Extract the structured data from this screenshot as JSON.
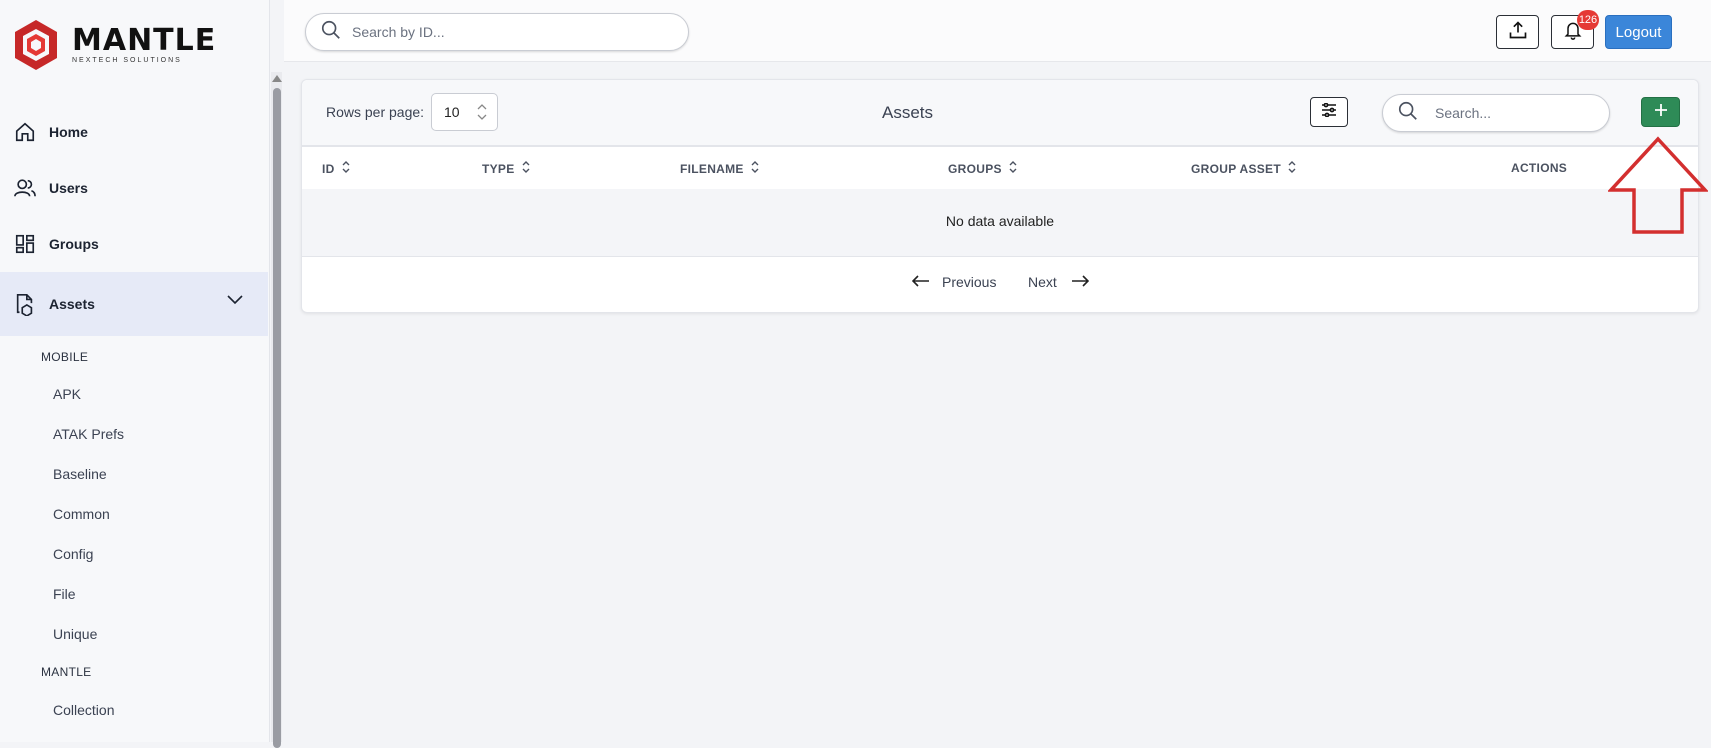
{
  "brand": {
    "name": "MANTLE",
    "tagline": "NEXTECH SOLUTIONS"
  },
  "sidebar": {
    "items": [
      {
        "label": "Home",
        "icon": "home-icon"
      },
      {
        "label": "Users",
        "icon": "users-icon"
      },
      {
        "label": "Groups",
        "icon": "groups-icon"
      },
      {
        "label": "Assets",
        "icon": "assets-icon"
      }
    ],
    "sections": [
      {
        "heading": "MOBILE",
        "items": [
          "APK",
          "ATAK Prefs",
          "Baseline",
          "Common",
          "Config",
          "File",
          "Unique"
        ]
      },
      {
        "heading": "MANTLE",
        "items": [
          "Collection"
        ]
      }
    ]
  },
  "topbar": {
    "search_placeholder": "Search by ID...",
    "notification_count": "126",
    "logout_label": "Logout"
  },
  "card": {
    "rows_per_page_label": "Rows per page:",
    "rows_per_page_value": "10",
    "title": "Assets",
    "search_placeholder": "Search...",
    "columns": [
      "ID",
      "TYPE",
      "FILENAME",
      "GROUPS",
      "GROUP ASSET",
      "ACTIONS"
    ],
    "empty_message": "No data available",
    "prev_label": "Previous",
    "next_label": "Next"
  },
  "colors": {
    "accent": "#3b86d9",
    "add": "#2e8b57",
    "badge": "#e53935",
    "annotation": "#d32f2f",
    "brand": "#c62828"
  }
}
